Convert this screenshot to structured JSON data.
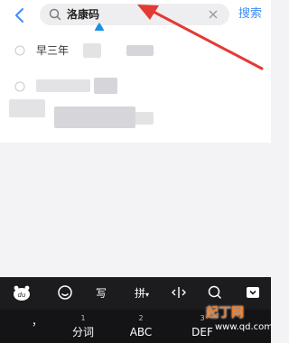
{
  "header": {
    "back_icon": "chevron-left-icon",
    "search_query": "洛康码",
    "clear_icon": "close-icon",
    "search_button_label": "搜索",
    "accent_color": "#3f8cf5"
  },
  "suggestions": [
    {
      "icon": "clock-icon",
      "text": "早三年"
    },
    {
      "icon": "clock-icon",
      "text": ""
    }
  ],
  "keyboard": {
    "toolbar": [
      "du-logo",
      "emoji-icon",
      "写",
      "拼",
      "cursor-icon",
      "search-icon",
      "collapse-icon"
    ],
    "toolbar_labels": {
      "handwrite": "写",
      "pinyin": "拼"
    },
    "keys": [
      {
        "num": "",
        "label": "，"
      },
      {
        "num": "1",
        "label": "分词"
      },
      {
        "num": "2",
        "label": "ABC"
      },
      {
        "num": "3",
        "label": "DEF"
      }
    ]
  },
  "watermark": {
    "text": "起丁网",
    "url": "www.qd.com"
  },
  "annotation_color": "#e53935"
}
